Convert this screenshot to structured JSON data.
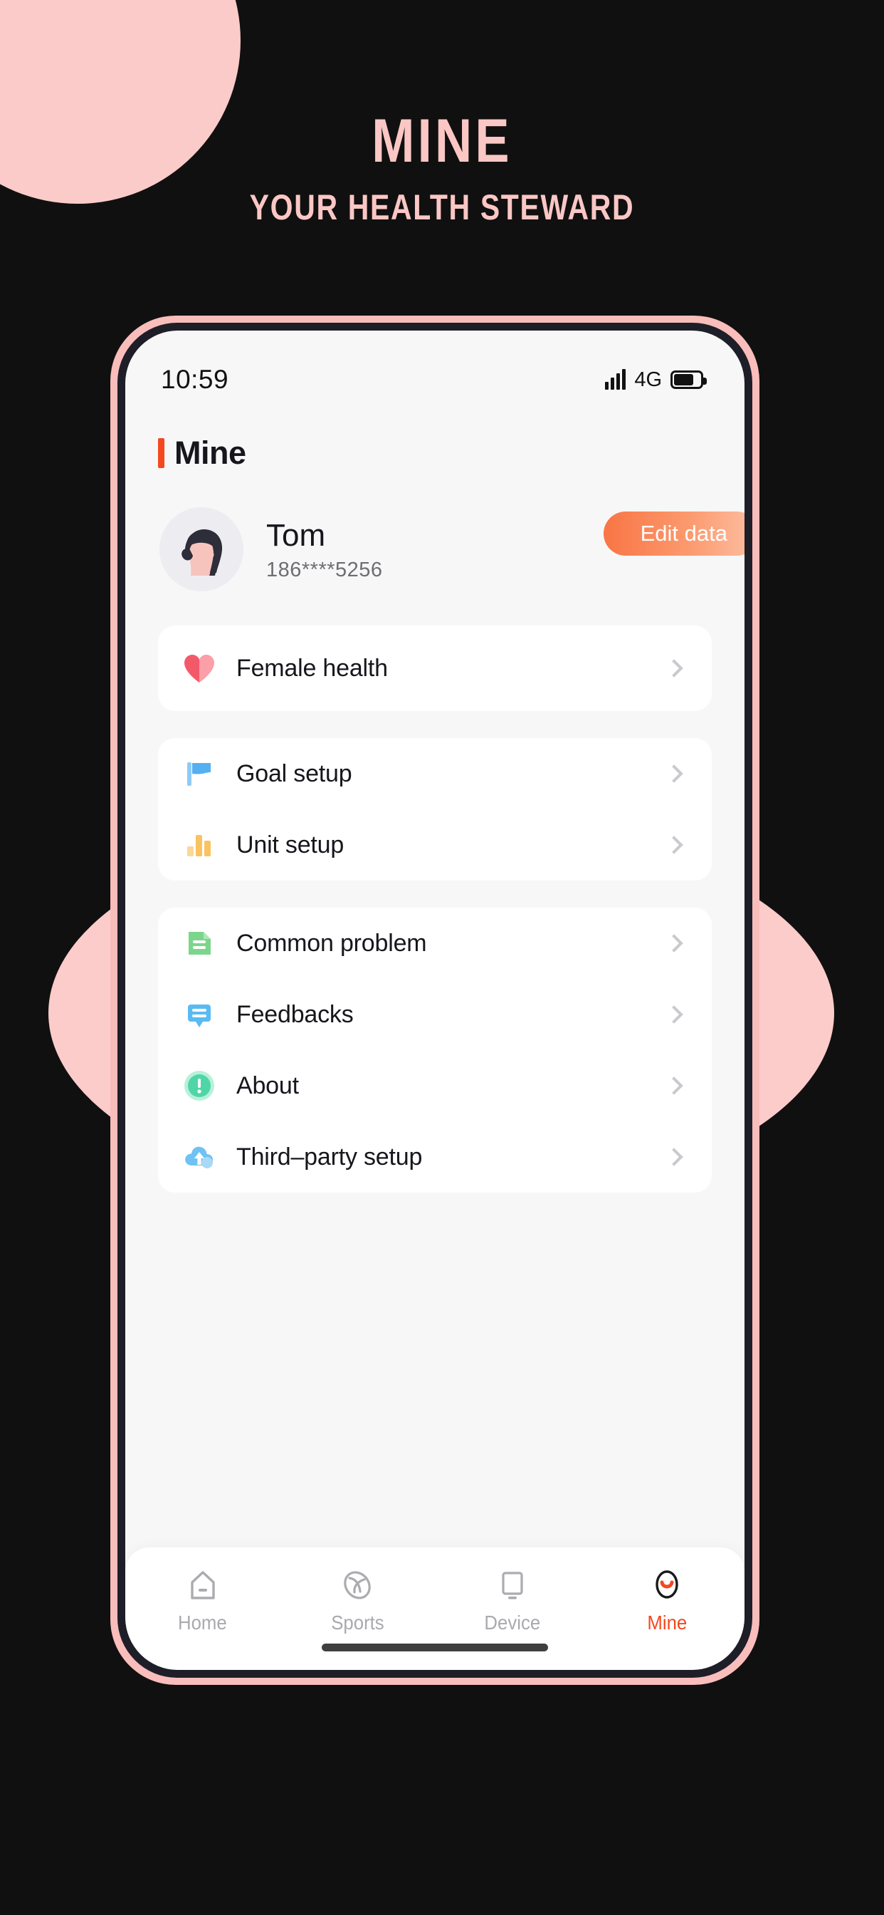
{
  "poster": {
    "background_color": "#111010",
    "accent_pink": "#FACBC9",
    "title": "MINE",
    "subtitle": "YOUR HEALTH STEWARD"
  },
  "status_bar": {
    "time": "10:59",
    "network": "4G",
    "signal_icon": "signal-bars-icon",
    "battery_icon": "battery-icon",
    "battery_level_percent": 76
  },
  "header": {
    "title": "Mine",
    "accent_color": "#F4481F"
  },
  "profile": {
    "avatar_icon": "avatar-illustration",
    "name": "Tom",
    "phone": "186****5256",
    "edit_button_label": "Edit data",
    "edit_button_gradient_from": "#F97545",
    "edit_button_gradient_to": "#FDC0A4"
  },
  "cards": [
    {
      "id": "female-health",
      "rows": [
        {
          "id": "female-health",
          "icon": "heart-icon",
          "label": "Female health",
          "chevron": "chevron-right-icon"
        }
      ]
    },
    {
      "id": "setup",
      "rows": [
        {
          "id": "goal-setup",
          "icon": "flag-icon",
          "label": "Goal setup",
          "chevron": "chevron-right-icon"
        },
        {
          "id": "unit-setup",
          "icon": "bar-chart-icon",
          "label": "Unit setup",
          "chevron": "chevron-right-icon"
        }
      ]
    },
    {
      "id": "info",
      "rows": [
        {
          "id": "common-problem",
          "icon": "document-icon",
          "label": "Common problem",
          "chevron": "chevron-right-icon"
        },
        {
          "id": "feedbacks",
          "icon": "speech-bubble-icon",
          "label": "Feedbacks",
          "chevron": "chevron-right-icon"
        },
        {
          "id": "about",
          "icon": "info-circle-icon",
          "label": "About",
          "chevron": "chevron-right-icon"
        },
        {
          "id": "third-party-setup",
          "icon": "cloud-upload-icon",
          "label": "Third–party setup",
          "chevron": "chevron-right-icon"
        }
      ]
    }
  ],
  "bottom_nav": {
    "active_color": "#F4481F",
    "inactive_color": "#A9A9AE",
    "items": [
      {
        "id": "home",
        "icon": "house-icon",
        "label": "Home",
        "active": false
      },
      {
        "id": "sports",
        "icon": "ball-icon",
        "label": "Sports",
        "active": false
      },
      {
        "id": "device",
        "icon": "monitor-icon",
        "label": "Device",
        "active": false
      },
      {
        "id": "mine",
        "icon": "face-icon",
        "label": "Mine",
        "active": true
      }
    ]
  }
}
